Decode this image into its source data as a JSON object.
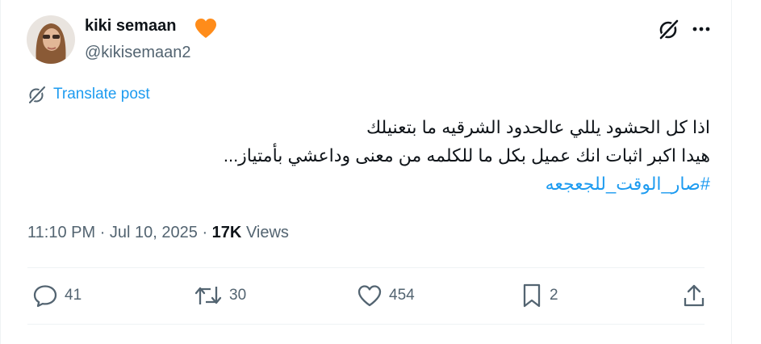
{
  "author": {
    "display_name": "kiki semaan",
    "handle": "@kikisemaan2",
    "badge_color": "#ff8c1a"
  },
  "translate": {
    "label": "Translate post"
  },
  "tweet": {
    "line1": "اذا كل الحشود يللي عالحدود الشرقيه ما بتعنيلك",
    "line2": "هيدا اكبر اثبات انك عميل بكل ما للكلمه من معنى وداعشي بأمتياز...",
    "hashtag": "#صار_الوقت_للجعجعه"
  },
  "meta": {
    "time": "11:10 PM",
    "date": "Jul 10, 2025",
    "views_count": "17K",
    "views_label": "Views"
  },
  "actions": {
    "replies": "41",
    "reposts": "30",
    "likes": "454",
    "bookmarks": "2"
  },
  "colors": {
    "accent": "#1d9bf0",
    "secondary_text": "#536471",
    "divider": "#eff3f4"
  }
}
